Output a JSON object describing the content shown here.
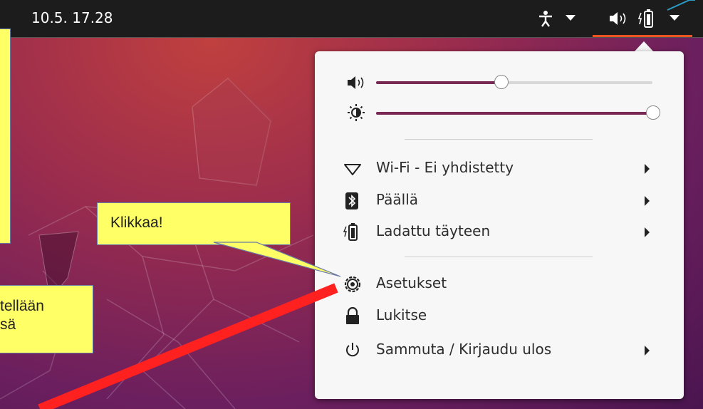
{
  "topbar": {
    "clock": "10.5.  17.28",
    "accent": "#e95420"
  },
  "menu": {
    "volume_level": 0.45,
    "brightness_level": 1.0,
    "items": [
      {
        "icon": "wifi-icon",
        "label": "Wi-Fi - Ei yhdistetty",
        "submenu": true
      },
      {
        "icon": "bluetooth-icon",
        "label": "Päällä",
        "submenu": true
      },
      {
        "icon": "battery-icon",
        "label": "Ladattu täyteen",
        "submenu": true
      },
      {
        "icon": "settings-gear-icon",
        "label": "Asetukset",
        "submenu": false
      },
      {
        "icon": "lock-icon",
        "label": "Lukitse",
        "submenu": false
      },
      {
        "icon": "power-icon",
        "label": "Sammuta / Kirjaudu ulos",
        "submenu": true
      }
    ]
  },
  "callouts": {
    "click": "Klikkaa!",
    "left_line1": "tellään",
    "left_line2": "sä"
  },
  "colors": {
    "note_fill": "#ffff66",
    "arrow_red": "#ff2020",
    "slider_fill": "#772953"
  }
}
